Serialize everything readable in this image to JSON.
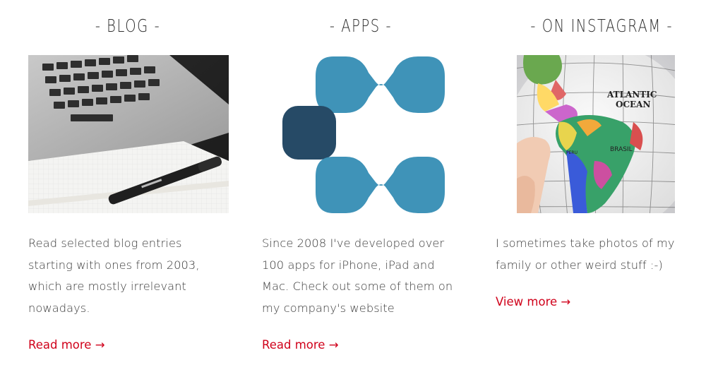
{
  "blog": {
    "heading": "- BLOG -",
    "description": "Read selected blog entries starting with ones from 2003, which are mostly irrelevant nowadays.",
    "link_label": "Read more →"
  },
  "apps": {
    "heading": "- APPS -",
    "description": "Since 2008 I've developed over 100 apps for iPhone, iPad and Mac. Check out some of them on my company's website",
    "link_label": "Read more →"
  },
  "instagram": {
    "heading": "- ON INSTAGRAM -",
    "description": "I sometimes take photos of my family or other weird stuff :-)",
    "link_label": "View more →",
    "globe_labels": {
      "atlantic": "ATLANTIC",
      "ocean": "OCEAN",
      "brasil": "BRASIL",
      "peru": "PERU"
    }
  },
  "colors": {
    "link": "#d0021b",
    "logo_light": "#3f93b8",
    "logo_dark": "#264a66"
  }
}
